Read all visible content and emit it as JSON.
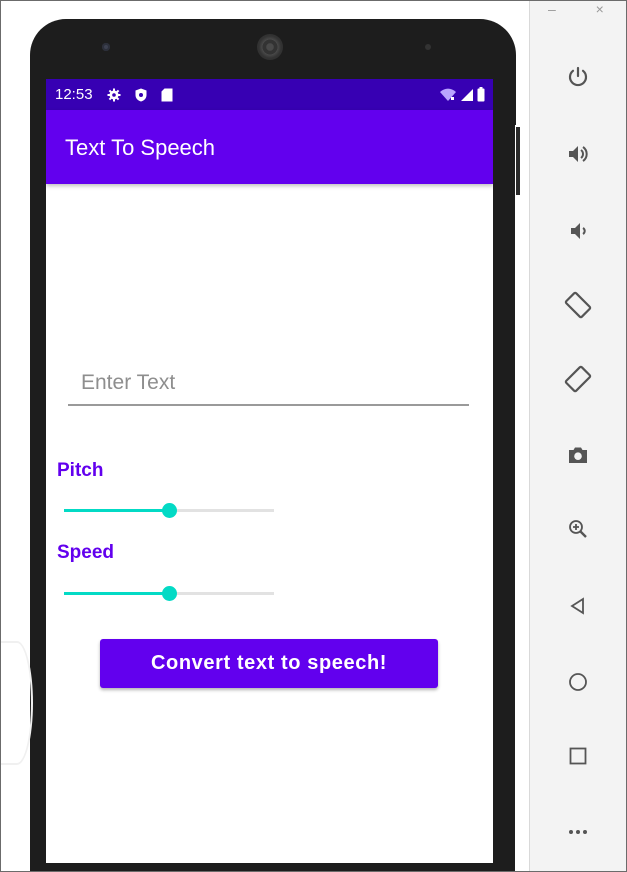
{
  "emulator": {
    "window_controls": "–   ×",
    "toolbar_icons": [
      "power-icon",
      "volume-up-icon",
      "volume-down-icon",
      "rotate-left-icon",
      "rotate-right-icon",
      "camera-icon",
      "zoom-icon",
      "back-icon",
      "home-icon",
      "overview-icon",
      "more-icon"
    ]
  },
  "status_bar": {
    "time": "12:53",
    "background": "#3700b3"
  },
  "app_bar": {
    "title": "Text To Speech",
    "background": "#6200ee"
  },
  "form": {
    "input_placeholder": "Enter Text",
    "input_value": "",
    "pitch": {
      "label": "Pitch",
      "value": 0.5
    },
    "speed": {
      "label": "Speed",
      "value": 0.5
    },
    "convert_button": "Convert text to speech!"
  },
  "colors": {
    "primary": "#6200ee",
    "accent": "#03dac5"
  }
}
